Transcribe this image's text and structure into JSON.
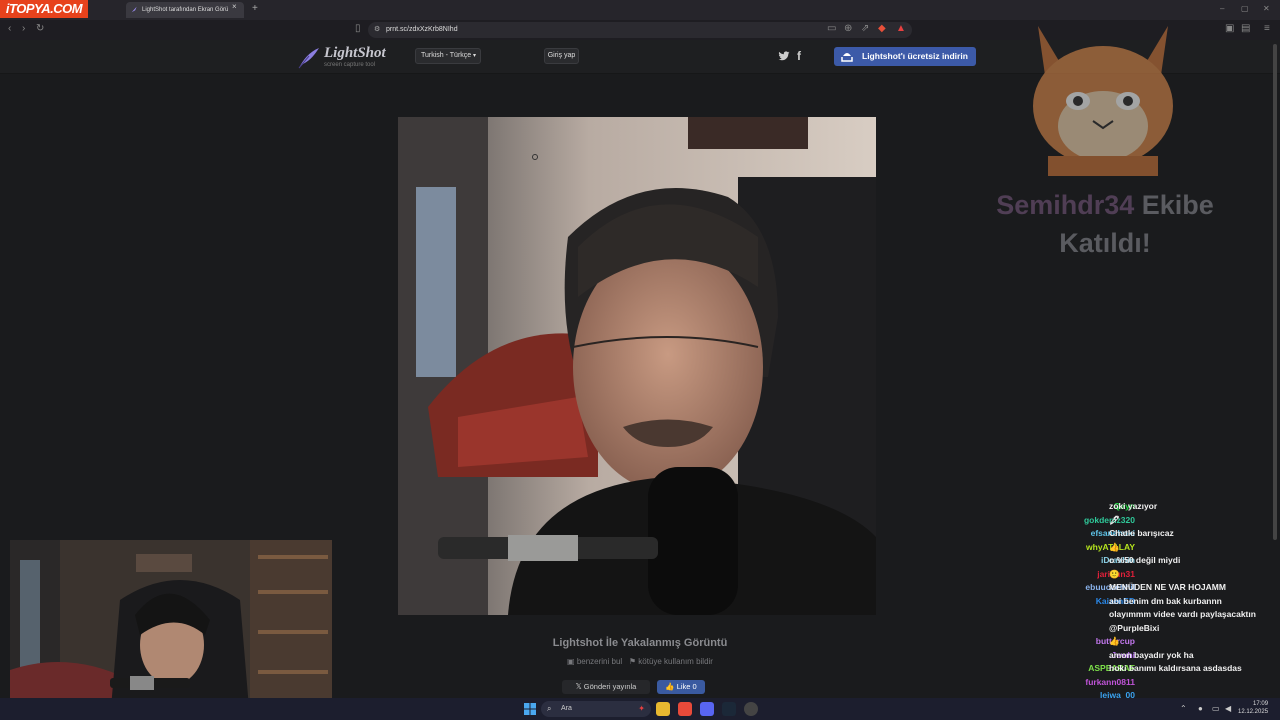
{
  "browser": {
    "brand_logo": "iTOPYA.COM",
    "tab_title": "LightShot tarafından Ekran Görü",
    "tab_close": "×",
    "new_tab": "+",
    "url": "prnt.sc/zdxXzKrb8NIhd",
    "win_min": "–",
    "win_max": "▢",
    "win_close": "✕"
  },
  "header": {
    "logo_title": "LightShot",
    "logo_sub": "screen capture tool",
    "language": "Turkish - Türkçe",
    "login": "Giriş yap",
    "download": "Lightshot'ı ücretsiz indirin",
    "facebook": "f"
  },
  "caption": {
    "title": "Lightshot İle Yakalanmış Görüntü",
    "find_similar": "benzerini bul",
    "report": "kötüye kullanım bildir",
    "tweet": "Gönderi yayınla",
    "like": "Like 0"
  },
  "overlay": {
    "follow_user": "Semihdr34",
    "follow_text1": "Ekibe",
    "follow_text2": "Katıldı!"
  },
  "chat": [
    {
      "user": "Qayn",
      "color": "#22dd44",
      "msg": "zoki yazıyor"
    },
    {
      "user": "gokdeniz320",
      "color": "#2fc99a",
      "msg": "🖋"
    },
    {
      "user": "efsanehoki",
      "color": "#5ec3e8",
      "msg": "Chatle barışıcaz"
    },
    {
      "user": "whyATALAY",
      "color": "#b7e71e",
      "msg": "👍"
    },
    {
      "user": "iDravhin",
      "color": "#8ad0e6",
      "msg": "o %50 değil miydi"
    },
    {
      "user": "jaridun31",
      "color": "#e0203a",
      "msg": "🙂"
    },
    {
      "user": "ebuuccehhil",
      "color": "#8ab3ec",
      "msg": "MENÜDEN NE VAR HOJAMM"
    },
    {
      "user": "KaizenED",
      "color": "#2a88e8",
      "msg": "abi benim dm bak kurbannn"
    },
    {
      "user": "",
      "color": "#ffffff",
      "msg": "olayımmm videe vardı paylaşacaktın"
    },
    {
      "user": "",
      "color": "#ffffff",
      "msg": "@PurpleBixi"
    },
    {
      "user": "buttercup",
      "color": "#c278ee",
      "msg": "👍"
    },
    {
      "user": "Jewhi",
      "color": "#b06be8",
      "msg": "amon bayadır yok ha"
    },
    {
      "user": "ASPEARAF",
      "color": "#7de04a",
      "msg": "hoki banımı kaldırsana asdasdas"
    },
    {
      "user": "furkann0811",
      "color": "#c054d8",
      "msg": ""
    },
    {
      "user": "leiwa_00",
      "color": "#3aa2f0",
      "msg": ""
    }
  ],
  "taskbar": {
    "search": "Ara",
    "time": "17:09",
    "date": "12.12.2025"
  },
  "colors": {
    "download_btn": "#3c5aa8",
    "like_btn": "#3a5aa0",
    "brand": "#e7421c"
  }
}
